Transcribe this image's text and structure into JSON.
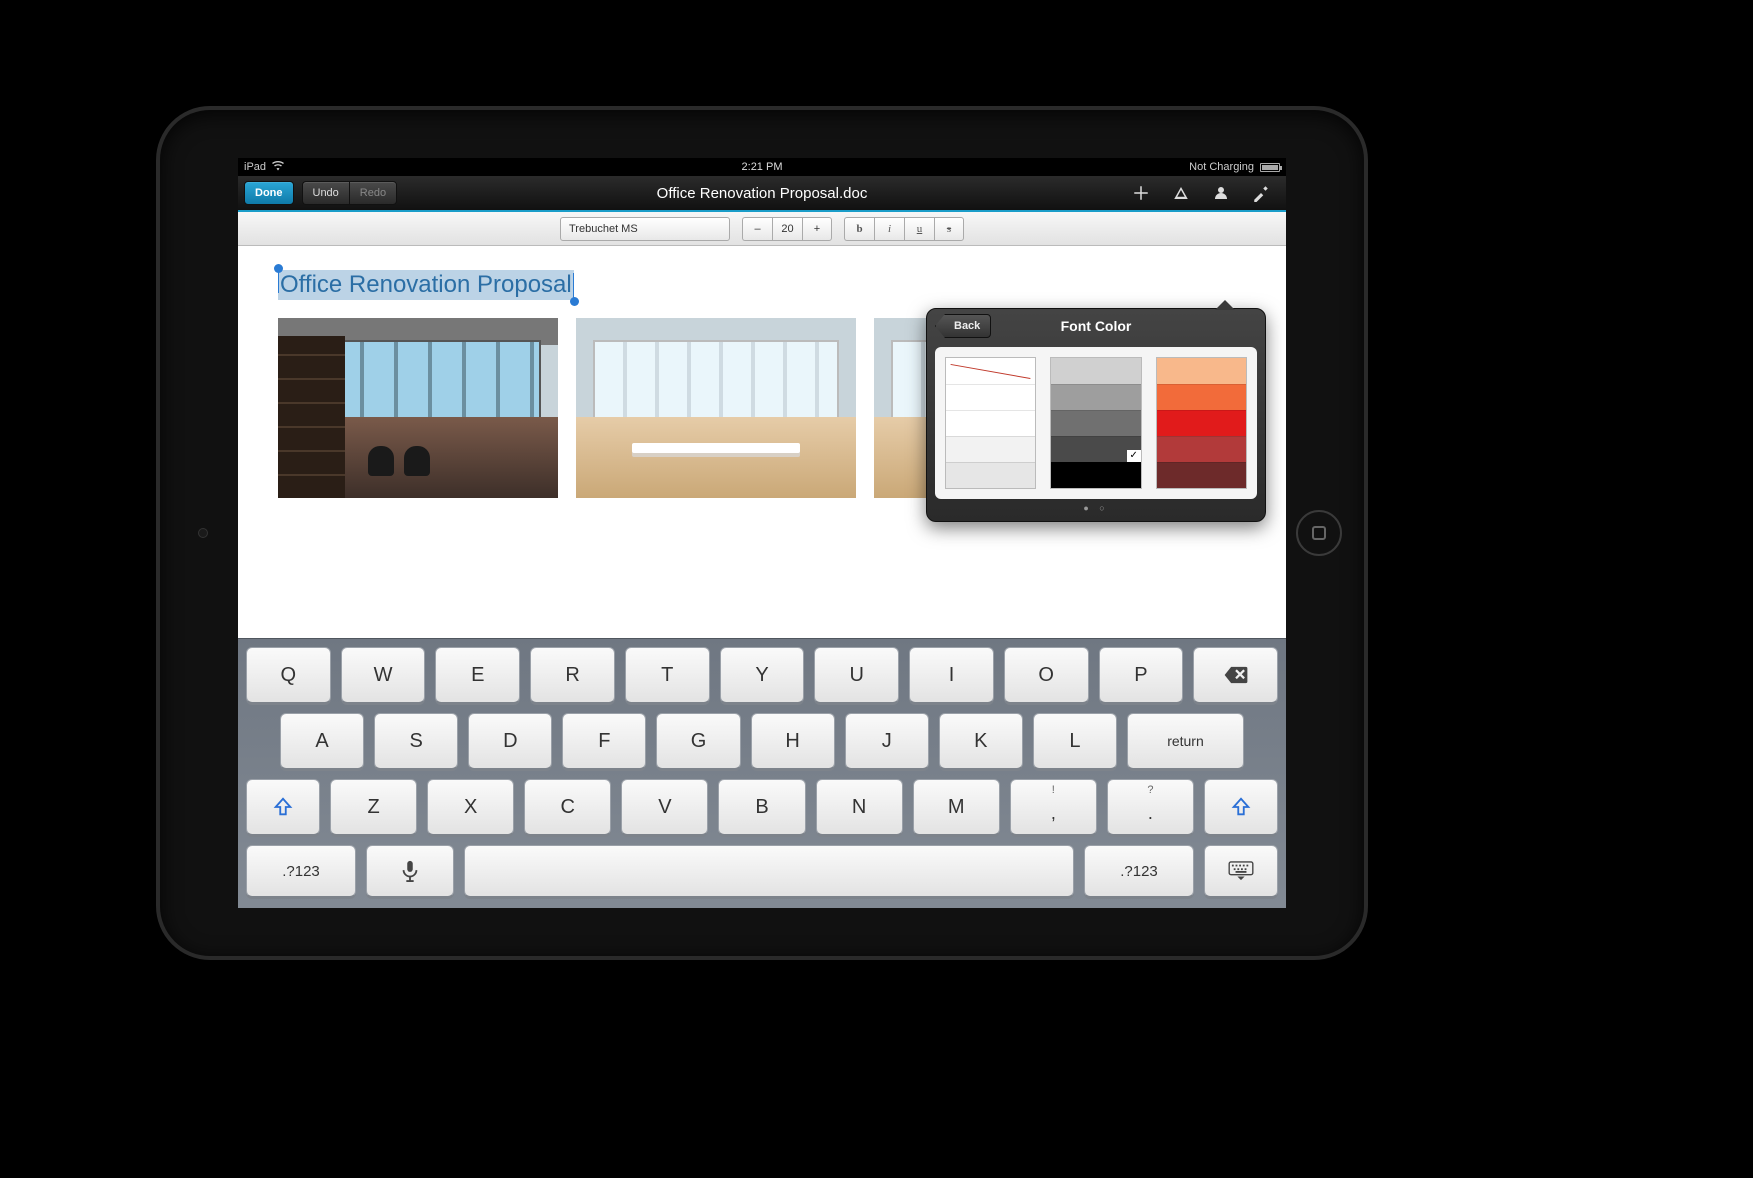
{
  "status": {
    "device": "iPad",
    "time": "2:21 PM",
    "charge": "Not Charging"
  },
  "nav": {
    "done": "Done",
    "undo": "Undo",
    "redo": "Redo",
    "title": "Office Renovation Proposal.doc"
  },
  "fmt": {
    "font": "Trebuchet MS",
    "size": "20",
    "b": "b",
    "i": "i",
    "u": "u",
    "s": "s",
    "minus": "–",
    "plus": "+"
  },
  "doc": {
    "heading": "Office Renovation Proposal"
  },
  "popover": {
    "back": "Back",
    "title": "Font Color",
    "col1": [
      {
        "c": "none"
      },
      {
        "c": "#ffffff"
      },
      {
        "c": "#ffffff"
      },
      {
        "c": "#f2f2f2"
      },
      {
        "c": "#e6e6e6"
      }
    ],
    "col2": [
      {
        "c": "#d0d0d0"
      },
      {
        "c": "#9e9e9e"
      },
      {
        "c": "#707070"
      },
      {
        "c": "#4a4a4a",
        "sel": true
      },
      {
        "c": "#000000"
      }
    ],
    "col3": [
      {
        "c": "#f8b88b"
      },
      {
        "c": "#f26b3a"
      },
      {
        "c": "#e11b1b"
      },
      {
        "c": "#b23a3a"
      },
      {
        "c": "#6d2a2a"
      }
    ]
  },
  "kbd": {
    "row1": [
      "Q",
      "W",
      "E",
      "R",
      "T",
      "Y",
      "U",
      "I",
      "O",
      "P"
    ],
    "row2": [
      "A",
      "S",
      "D",
      "F",
      "G",
      "H",
      "J",
      "K",
      "L"
    ],
    "row3": [
      "Z",
      "X",
      "C",
      "V",
      "B",
      "N",
      "M"
    ],
    "punct1": {
      "alt": "!",
      "main": ","
    },
    "punct2": {
      "alt": "?",
      "main": "."
    },
    "return": "return",
    "nums": ".?123"
  }
}
